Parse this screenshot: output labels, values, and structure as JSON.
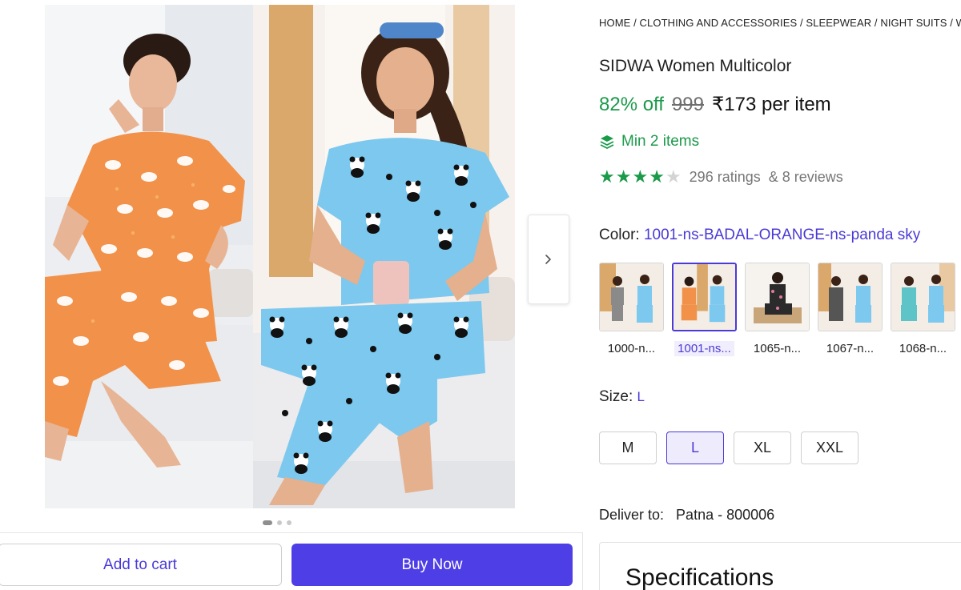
{
  "breadcrumb": {
    "text": "HOME / CLOTHING AND ACCESSORIES / SLEEPWEAR / NIGHT SUITS / W"
  },
  "product": {
    "title": "SIDWA Women Multicolor",
    "discount": "82% off",
    "mrp": "999",
    "price": "₹173 per item",
    "min_order": "Min 2 items",
    "rating": 4,
    "rating_max": 5,
    "ratings_count": "296 ratings",
    "reviews_count": "& 8 reviews"
  },
  "color": {
    "label": "Color:",
    "selected": "1001-ns-BADAL-ORANGE-ns-panda sky",
    "swatches": [
      {
        "label": "1000-n...",
        "selected": false
      },
      {
        "label": "1001-ns...",
        "selected": true
      },
      {
        "label": "1065-n...",
        "selected": false
      },
      {
        "label": "1067-n...",
        "selected": false
      },
      {
        "label": "1068-n...",
        "selected": false
      }
    ]
  },
  "size": {
    "label": "Size:",
    "selected": "L",
    "options": [
      "M",
      "L",
      "XL",
      "XXL"
    ]
  },
  "delivery": {
    "label": "Deliver to:",
    "location": "Patna - 800006"
  },
  "specifications": {
    "title": "Specifications"
  },
  "actions": {
    "add_to_cart": "Add to cart",
    "buy_now": "Buy Now"
  },
  "gallery": {
    "dot_count": 3,
    "active_dot": 0,
    "next_icon": "chevron-right-icon"
  },
  "colors": {
    "accent": "#4e3ee6",
    "discount_green": "#1b9a4a",
    "orange_suit": "#f2924a",
    "sky_suit": "#7cc8ee"
  }
}
